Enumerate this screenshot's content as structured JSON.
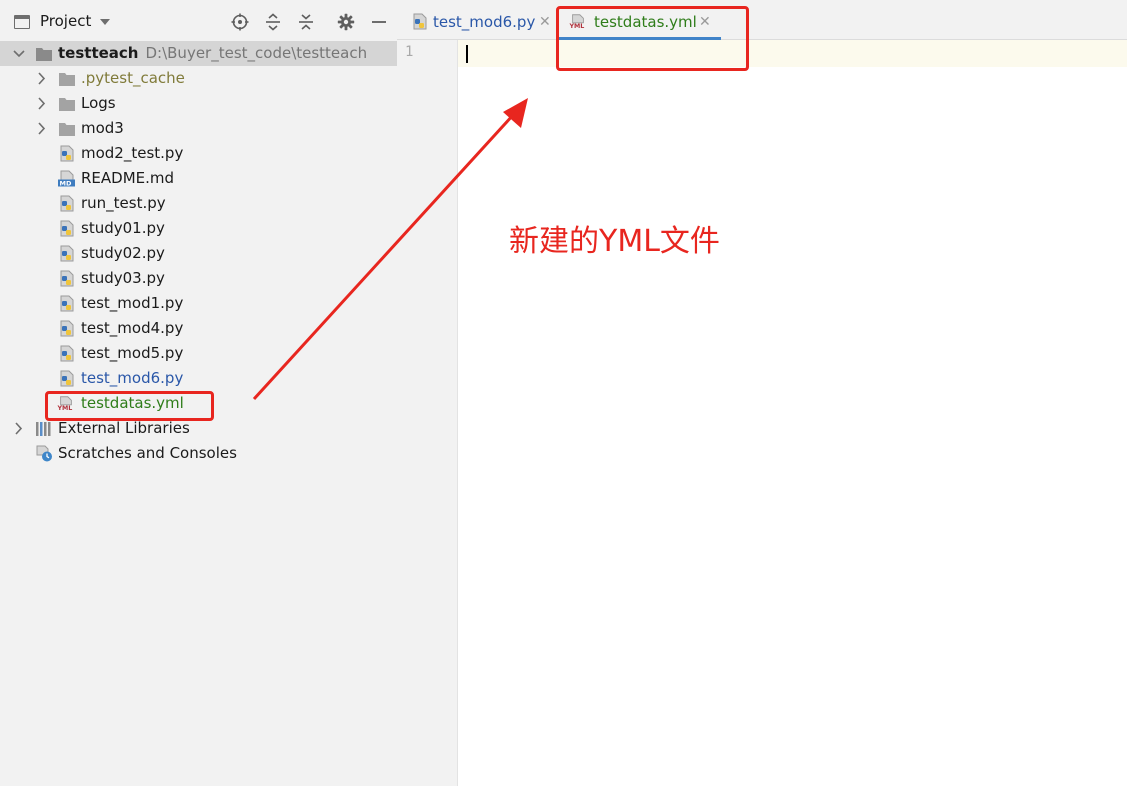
{
  "project_panel": {
    "title": "Project",
    "toolbar_icons": [
      "locate-icon",
      "expand-all-icon",
      "collapse-all-icon",
      "gear-icon",
      "minimize-icon"
    ]
  },
  "tree": {
    "root": {
      "name": "testteach",
      "path": "D:\\Buyer_test_code\\testteach"
    },
    "items": [
      {
        "label": ".pytest_cache",
        "kind": "folder"
      },
      {
        "label": "Logs",
        "kind": "folder"
      },
      {
        "label": "mod3",
        "kind": "folder"
      },
      {
        "label": "mod2_test.py",
        "kind": "python"
      },
      {
        "label": "README.md",
        "kind": "markdown"
      },
      {
        "label": "run_test.py",
        "kind": "python"
      },
      {
        "label": "study01.py",
        "kind": "python"
      },
      {
        "label": "study02.py",
        "kind": "python"
      },
      {
        "label": "study03.py",
        "kind": "python"
      },
      {
        "label": "test_mod1.py",
        "kind": "python"
      },
      {
        "label": "test_mod4.py",
        "kind": "python"
      },
      {
        "label": "test_mod5.py",
        "kind": "python"
      },
      {
        "label": "test_mod6.py",
        "kind": "python"
      },
      {
        "label": "testdatas.yml",
        "kind": "yaml"
      }
    ],
    "external_libraries": "External Libraries",
    "scratches": "Scratches and Consoles"
  },
  "editor": {
    "tabs": [
      {
        "label": "test_mod6.py",
        "active": false
      },
      {
        "label": "testdatas.yml",
        "active": true
      }
    ],
    "tab_close_glyph": "✕",
    "line_number": "1"
  },
  "annotation": {
    "text": "新建的YML文件",
    "color": "#e8261f"
  },
  "colors": {
    "panel_bg": "#f2f2f2",
    "selected_row": "#d5d5d5",
    "active_tab_underline": "#4083c9",
    "current_line": "#fcfaed",
    "ignored_file": "#807b3a",
    "modified_file": "#2a57a8",
    "new_file": "#2f7d1a"
  }
}
